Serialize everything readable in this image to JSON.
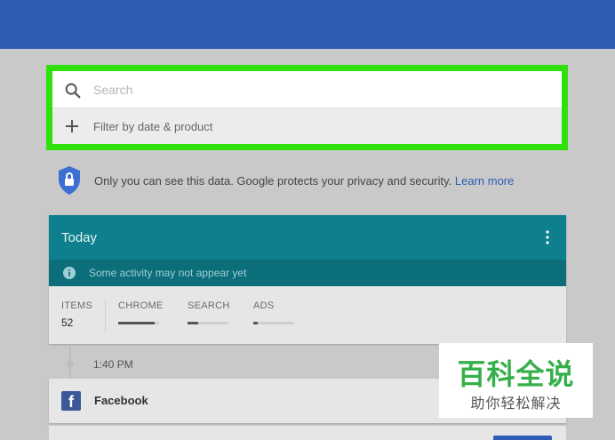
{
  "search": {
    "placeholder": "Search",
    "filter_label": "Filter by date & product"
  },
  "privacy": {
    "text": "Only you can see this data. Google protects your privacy and security.",
    "link": "Learn more"
  },
  "today": {
    "title": "Today",
    "notice": "Some activity may not appear yet",
    "items_label": "ITEMS",
    "items_value": "52",
    "products": [
      {
        "label": "CHROME",
        "level": 0.9
      },
      {
        "label": "SEARCH",
        "level": 0.25
      },
      {
        "label": "ADS",
        "level": 0.1
      }
    ]
  },
  "timeline": {
    "time": "1:40 PM"
  },
  "entry": {
    "app": "Facebook",
    "icon_letter": "f"
  },
  "watermark": {
    "title": "百科全说",
    "subtitle": "助你轻松解决"
  },
  "colors": {
    "topbar": "#2f5bb5",
    "highlight": "#2fe00c",
    "card_header": "#0e7f8c",
    "link": "#2f5bb5"
  }
}
